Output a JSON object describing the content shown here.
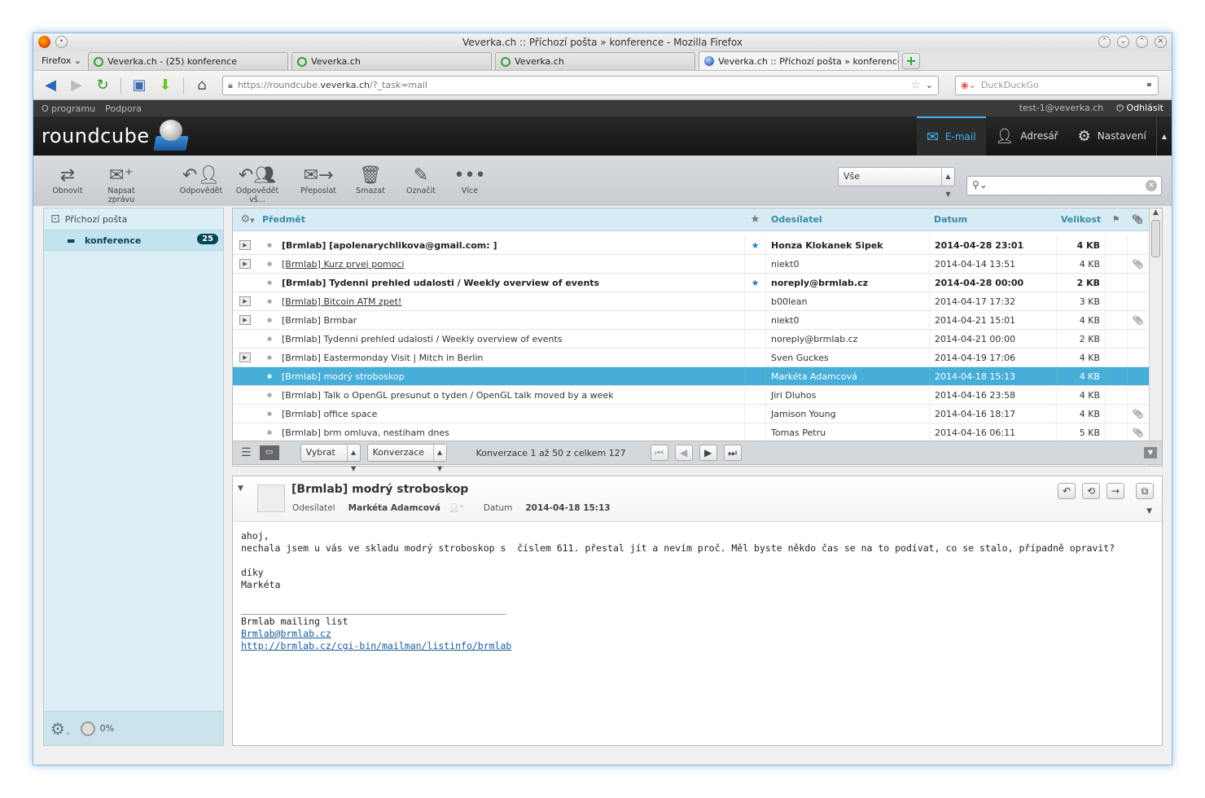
{
  "window": {
    "title": "Veverka.ch :: Příchozí pošta » konference - Mozilla Firefox"
  },
  "browser": {
    "menu_label": "Firefox",
    "tabs": [
      {
        "label": "Veverka.ch - (25) konference"
      },
      {
        "label": "Veverka.ch"
      },
      {
        "label": "Veverka.ch"
      },
      {
        "label": "Veverka.ch :: Příchozí pošta » konference"
      }
    ],
    "url_prefix": "https://roundcube.",
    "url_domain": "veverka.ch",
    "url_path": "/?_task=mail",
    "search_placeholder": "DuckDuckGo"
  },
  "topbar": {
    "about": "O programu",
    "support": "Podpora",
    "user": "test-1@veverka.ch",
    "logout": "Odhlásit"
  },
  "header": {
    "logo": "roundcube",
    "nav": [
      {
        "label": "E-mail",
        "icon": "envelope-icon"
      },
      {
        "label": "Adresář",
        "icon": "person-icon"
      },
      {
        "label": "Nastavení",
        "icon": "gear-icon"
      }
    ]
  },
  "toolbar": {
    "refresh": "Obnovit",
    "compose": "Napsat zprávu",
    "reply": "Odpovědět",
    "reply_all": "Odpovědět vš...",
    "forward": "Přeposlat",
    "delete": "Smazat",
    "mark": "Označit",
    "more": "Více",
    "filter": "Vše"
  },
  "folders": {
    "inbox": "Příchozí pošta",
    "conference": "konference",
    "conference_count": "25",
    "quota": "0%"
  },
  "list": {
    "columns": {
      "subject": "Předmět",
      "from": "Odesílatel",
      "date": "Datum",
      "size": "Velikost"
    },
    "rows": [
      {
        "subject": "[Brmlab] [apolenarychlikova@gmail.com: ]",
        "from": "Honza Klokanek Sipek",
        "date": "2014-04-28 23:01",
        "size": "4 KB"
      },
      {
        "subject": "[Brmlab] Kurz prvej pomoci",
        "from": "niekt0",
        "date": "2014-04-14 13:51",
        "size": "4 KB"
      },
      {
        "subject": "[Brmlab] Tydenni prehled udalosti / Weekly overview of events",
        "from": "noreply@brmlab.cz",
        "date": "2014-04-28 00:00",
        "size": "2 KB"
      },
      {
        "subject": "[Brmlab] Bitcoin ATM zpet!",
        "from": "b00lean",
        "date": "2014-04-17 17:32",
        "size": "3 KB"
      },
      {
        "subject": "[Brmlab] Brmbar",
        "from": "niekt0",
        "date": "2014-04-21 15:01",
        "size": "4 KB"
      },
      {
        "subject": "[Brmlab] Tydenni prehled udalosti / Weekly overview of events",
        "from": "noreply@brmlab.cz",
        "date": "2014-04-21 00:00",
        "size": "2 KB"
      },
      {
        "subject": "[Brmlab] Eastermonday Visit | Mitch in Berlin",
        "from": "Sven Guckes",
        "date": "2014-04-19 17:06",
        "size": "4 KB"
      },
      {
        "subject": "[Brmlab] modrý stroboskop",
        "from": "Markéta Adamcová",
        "date": "2014-04-18 15:13",
        "size": "4 KB"
      },
      {
        "subject": "[Brmlab] Talk o OpenGL presunut o tyden / OpenGL talk moved by a week",
        "from": "Jiri Dluhos",
        "date": "2014-04-16 23:58",
        "size": "4 KB"
      },
      {
        "subject": "[Brmlab] office space",
        "from": "Jamison Young",
        "date": "2014-04-16 18:17",
        "size": "4 KB"
      },
      {
        "subject": "[Brmlab] brm omluva, nestiham dnes",
        "from": "Tomas Petru",
        "date": "2014-04-16 06:11",
        "size": "5 KB"
      }
    ],
    "footer": {
      "select": "Vybrat",
      "threads": "Konverzace",
      "count": "Konverzace 1 až 50 z celkem 127"
    }
  },
  "preview": {
    "subject": "[Brmlab] modrý stroboskop",
    "from_label": "Odesílatel",
    "from": "Markéta Adamcová",
    "date_label": "Datum",
    "date": "2014-04-18 15:13",
    "body": "ahoj,\nnechala jsem u vás ve skladu modrý stroboskop s  číslem 611. přestal jít a nevím proč. Měl byste někdo čas se na to podívat, co se stalo, případně opravit?\n\ndíky\nMarkéta",
    "sig_separator": "_______________________________________________",
    "list_name": "Brmlab mailing list",
    "list_email": "Brmlab@brmlab.cz",
    "list_url": "http://brmlab.cz/cgi-bin/mailman/listinfo/brmlab"
  }
}
